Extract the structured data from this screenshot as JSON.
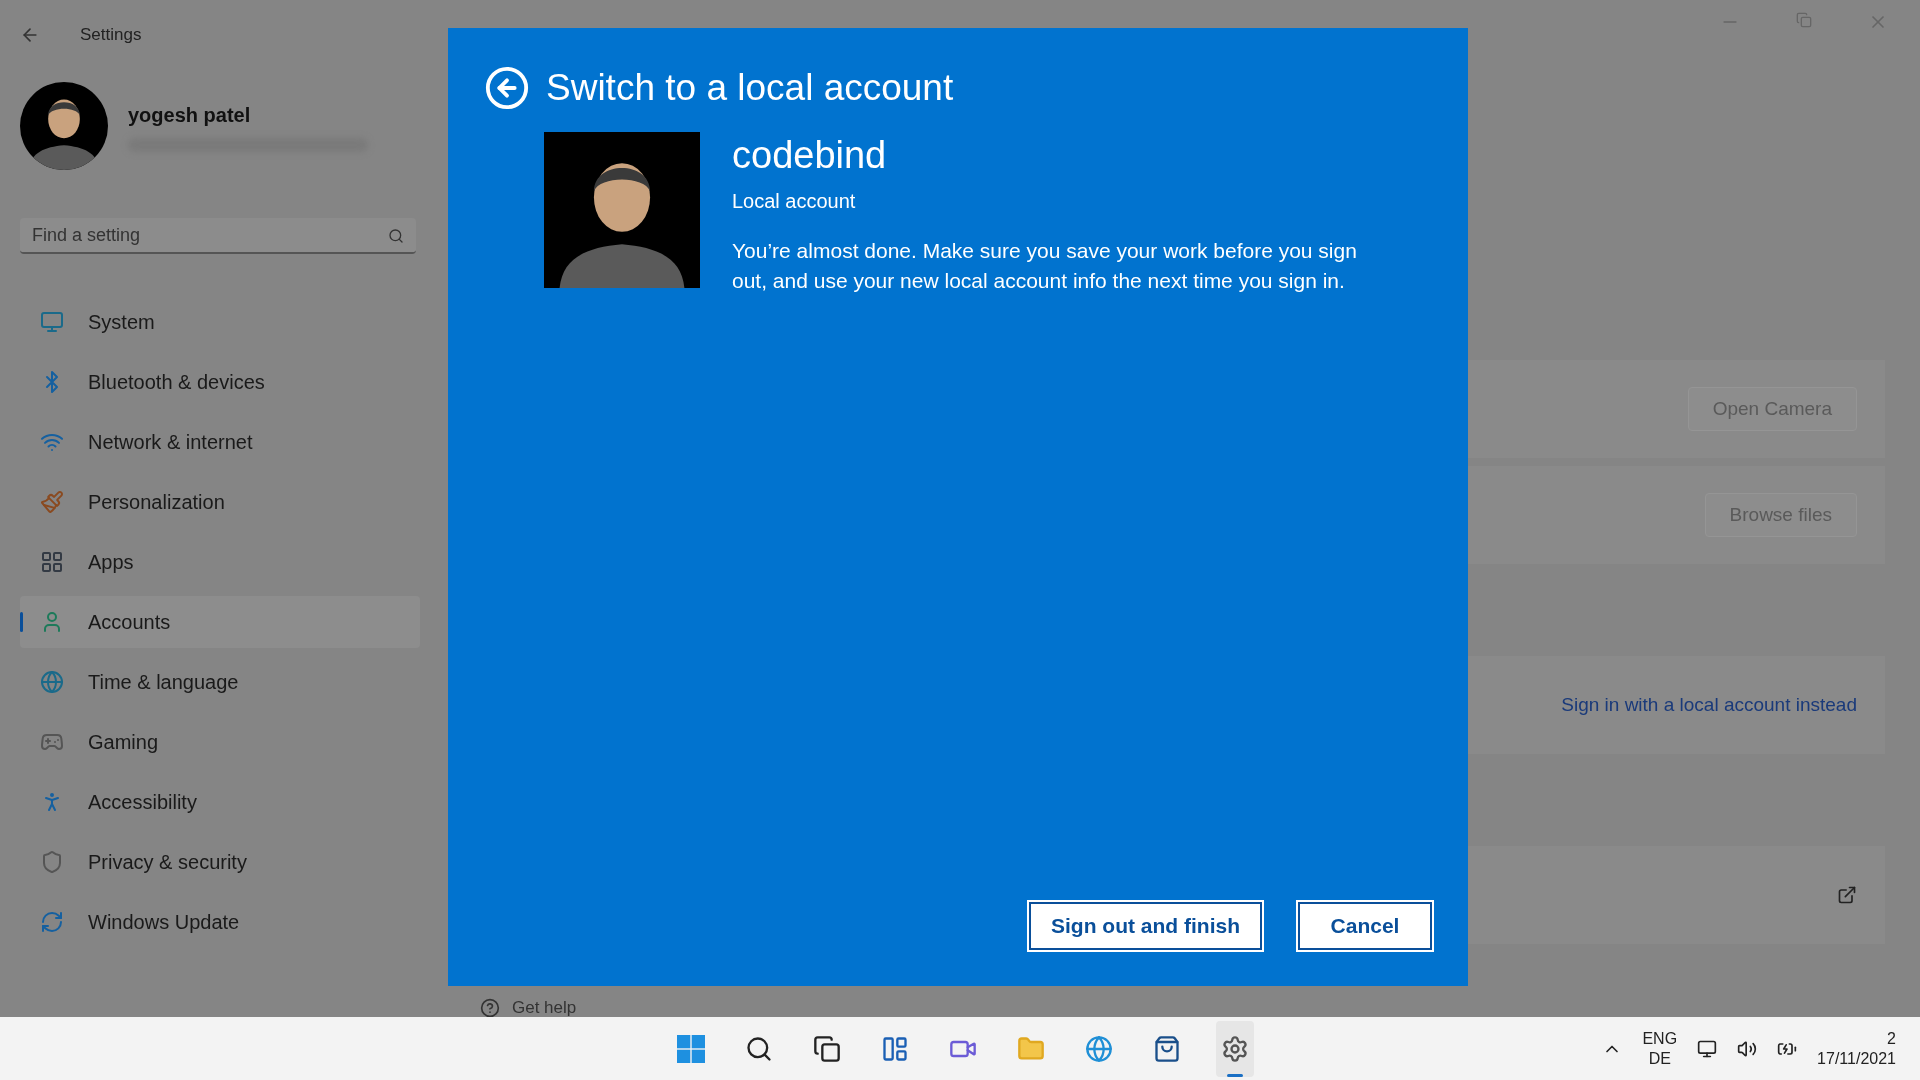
{
  "window": {
    "title": "Settings"
  },
  "profile": {
    "name": "yogesh patel"
  },
  "search": {
    "placeholder": "Find a setting"
  },
  "nav": [
    {
      "label": "System",
      "selected": false
    },
    {
      "label": "Bluetooth & devices",
      "selected": false
    },
    {
      "label": "Network & internet",
      "selected": false
    },
    {
      "label": "Personalization",
      "selected": false
    },
    {
      "label": "Apps",
      "selected": false
    },
    {
      "label": "Accounts",
      "selected": true
    },
    {
      "label": "Time & language",
      "selected": false
    },
    {
      "label": "Gaming",
      "selected": false
    },
    {
      "label": "Accessibility",
      "selected": false
    },
    {
      "label": "Privacy & security",
      "selected": false
    },
    {
      "label": "Windows Update",
      "selected": false
    }
  ],
  "content": {
    "cards": [
      {
        "kind": "button",
        "label": "Open Camera"
      },
      {
        "kind": "button",
        "label": "Browse files"
      },
      {
        "kind": "link",
        "label": "Sign in with a local account instead"
      },
      {
        "kind": "external"
      }
    ],
    "get_help": "Get help"
  },
  "dialog": {
    "title": "Switch to a local account",
    "account_name": "codebind",
    "account_type": "Local account",
    "message": "You’re almost done. Make sure you save your work before you sign out, and use your new local account info the next time you sign in.",
    "buttons": [
      {
        "label": "Sign out and finish"
      },
      {
        "label": "Cancel"
      }
    ]
  },
  "taskbar": {
    "apps": [
      {
        "selected": false
      },
      {
        "selected": false
      },
      {
        "selected": false
      },
      {
        "selected": false
      },
      {
        "selected": false
      },
      {
        "selected": false
      },
      {
        "selected": false
      },
      {
        "selected": false
      },
      {
        "selected": true
      }
    ],
    "language": [
      "ENG",
      "DE"
    ],
    "time": "2",
    "date": "17/11/2021"
  }
}
